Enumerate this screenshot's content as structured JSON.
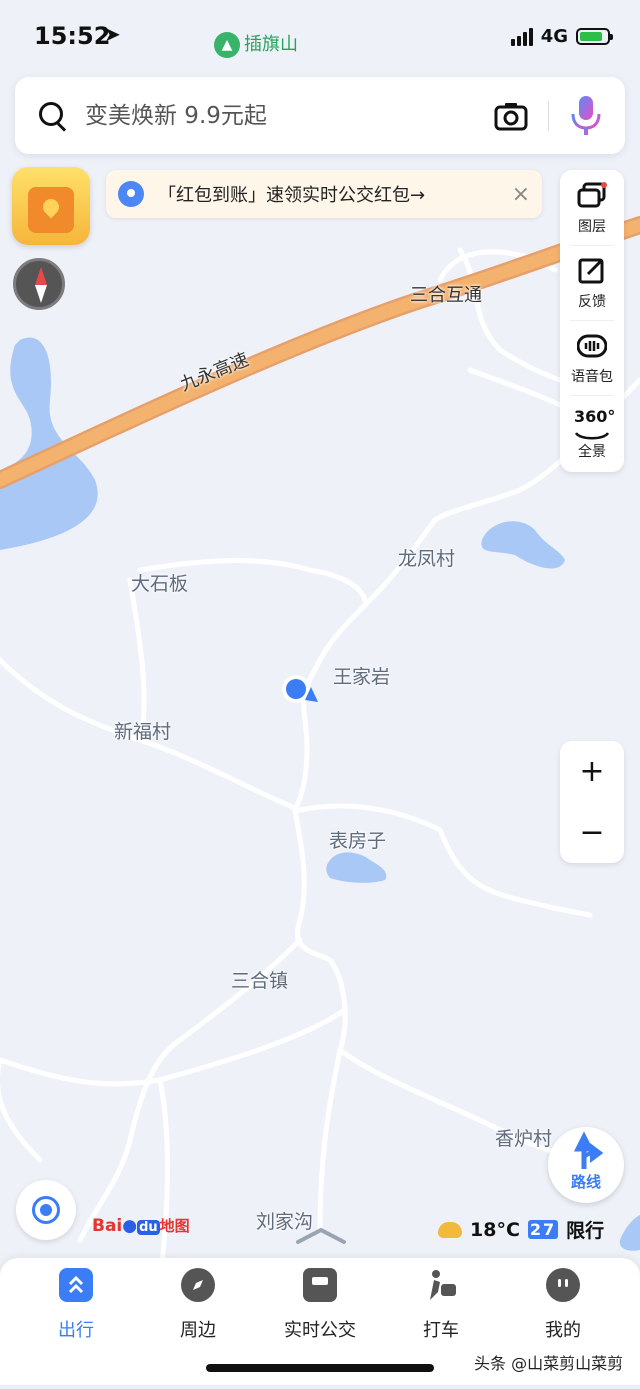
{
  "status_bar": {
    "time": "15:52",
    "location_arrow": "location-arrow-icon",
    "place_chip": "插旗山",
    "network": "4G"
  },
  "search": {
    "placeholder": "变美焕新 9.9元起"
  },
  "banner": {
    "text": "「红包到账」速领实时公交红包→",
    "close": "×"
  },
  "toolbar": {
    "items": [
      {
        "label": "图层",
        "icon": "layers-icon"
      },
      {
        "label": "反馈",
        "icon": "feedback-edit-icon"
      },
      {
        "label": "语音包",
        "icon": "voice-pack-icon"
      },
      {
        "label": "全景",
        "icon": "panorama-360-icon",
        "badge": "360°"
      }
    ]
  },
  "zoom": {
    "in": "+",
    "out": "−"
  },
  "map_labels": {
    "highway": "九永高速",
    "interchange": "三合互通",
    "places": [
      "龙凤村",
      "大石板",
      "王家岩",
      "新福村",
      "表房子",
      "三合镇",
      "香炉村",
      "刘家沟"
    ]
  },
  "route_button": {
    "label": "路线"
  },
  "baidu_logo": {
    "bai": "Bai",
    "du": "du",
    "map": "地图"
  },
  "weather": {
    "temperature": "18°C",
    "limit_numbers": "27",
    "limit_label": "限行"
  },
  "bottom_nav": {
    "items": [
      {
        "label": "出行",
        "icon": "travel-icon",
        "active": true
      },
      {
        "label": "周边",
        "icon": "compass-nearby-icon",
        "active": false
      },
      {
        "label": "实时公交",
        "icon": "bus-icon",
        "active": false
      },
      {
        "label": "打车",
        "icon": "taxi-icon",
        "active": false
      },
      {
        "label": "我的",
        "icon": "profile-icon",
        "active": false
      }
    ]
  },
  "watermark": "头条 @山菜剪山菜剪",
  "colors": {
    "accent": "#3a7df4",
    "highway": "#f4b26f",
    "water": "#a9c8f5",
    "map_bg": "#eef1f8"
  }
}
